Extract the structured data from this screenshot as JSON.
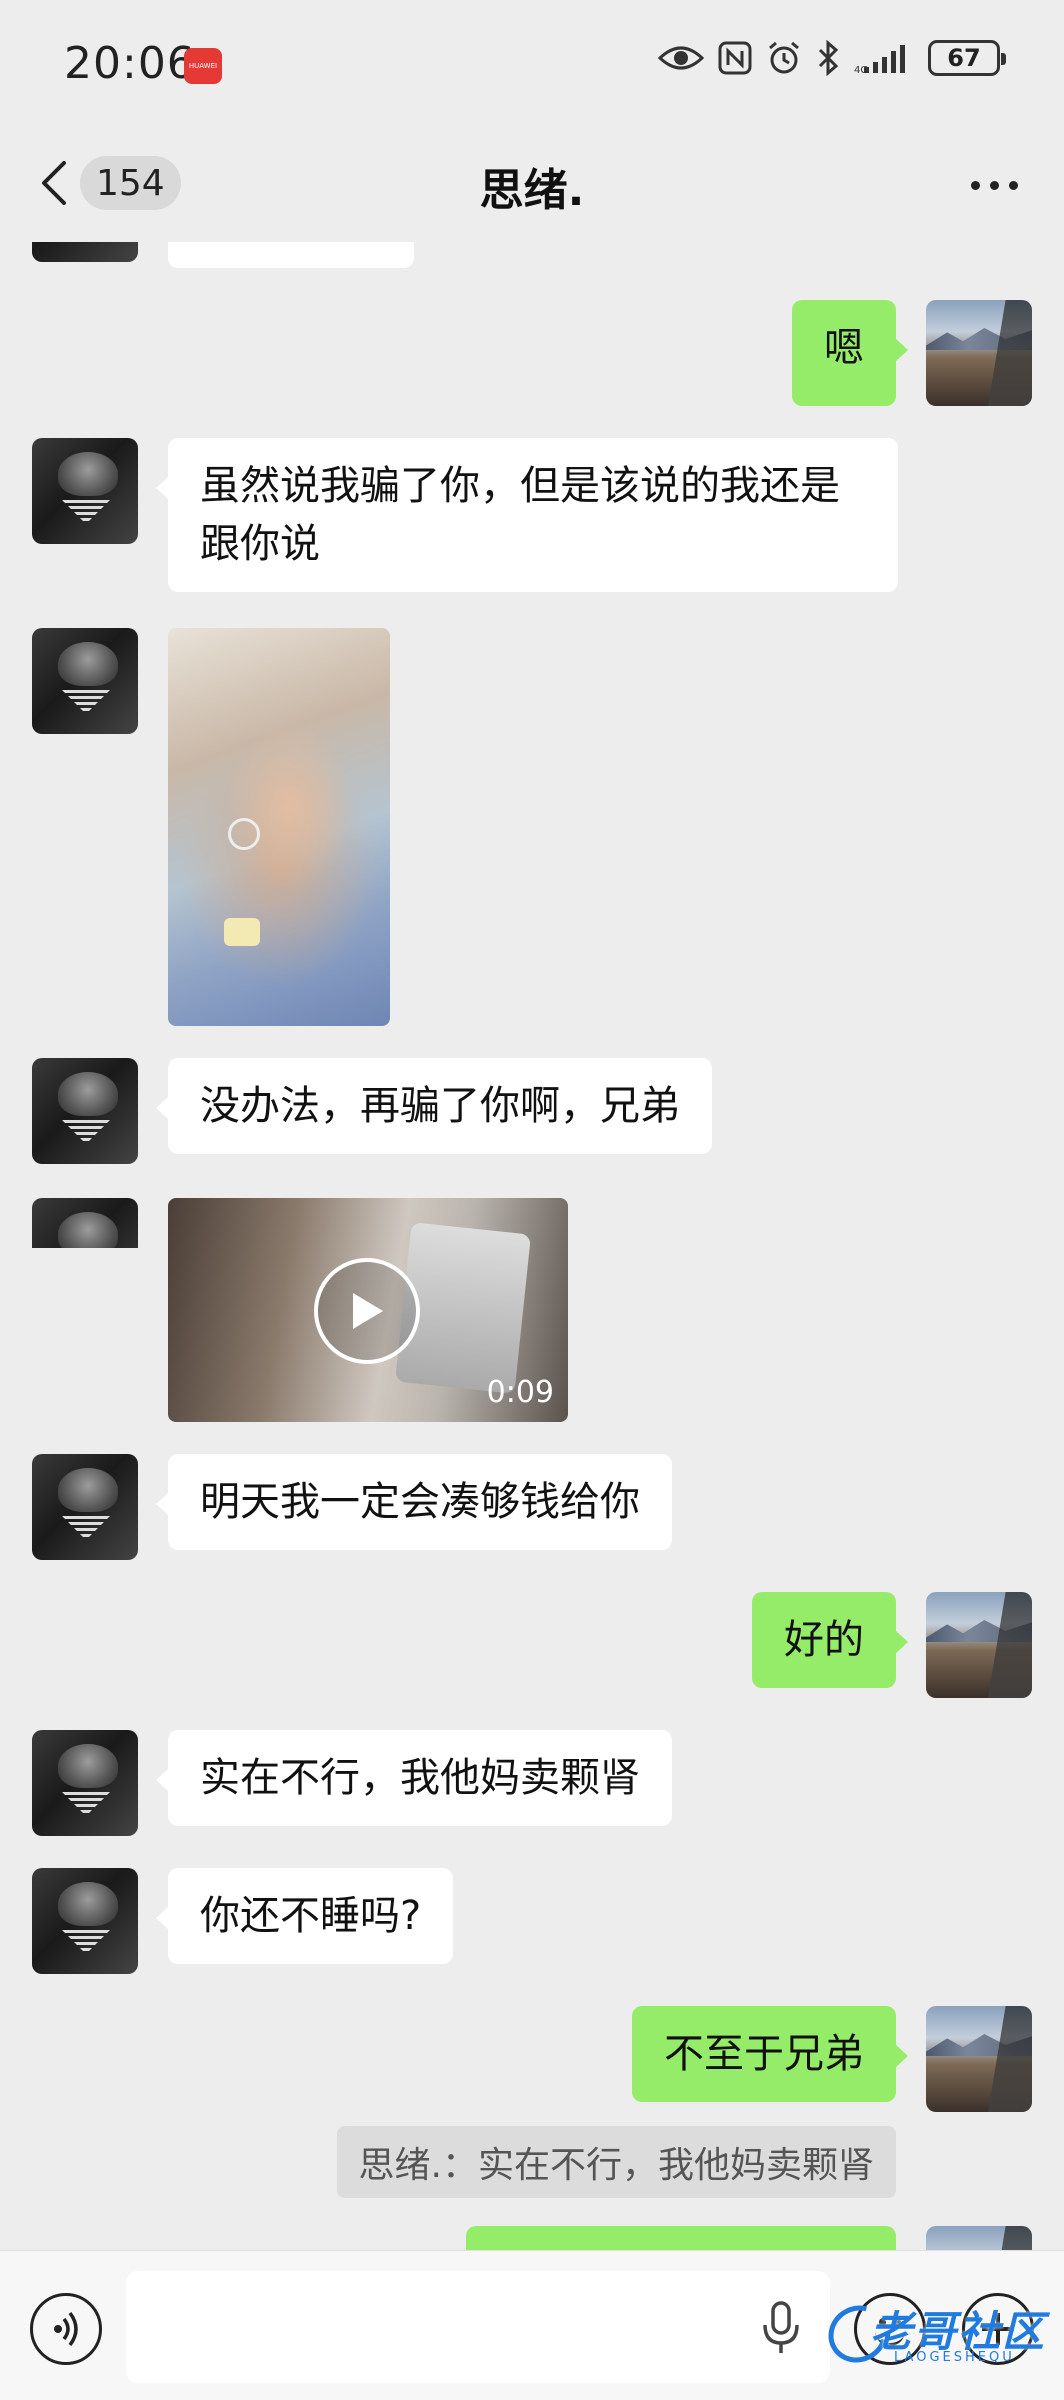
{
  "status_bar": {
    "time": "20:06",
    "badge": "HUAWEI",
    "battery": "67",
    "icons": [
      "eye-icon",
      "nfc-icon",
      "alarm-icon",
      "bluetooth-icon",
      "signal-icon",
      "battery-icon"
    ]
  },
  "nav": {
    "unread_count": "154",
    "title": "思绪.",
    "icons": [
      "chevron-left-icon",
      "more-icon"
    ]
  },
  "messages": [
    {
      "side": "in",
      "type": "text",
      "text": ""
    },
    {
      "side": "out",
      "type": "text",
      "text": "嗯"
    },
    {
      "side": "in",
      "type": "text",
      "text": "虽然说我骗了你，但是该说的我还是跟你说"
    },
    {
      "side": "in",
      "type": "image"
    },
    {
      "side": "in",
      "type": "text",
      "text": "没办法，再骗了你啊，兄弟"
    },
    {
      "side": "in",
      "type": "video",
      "duration": "0:09"
    },
    {
      "side": "in",
      "type": "text",
      "text": "明天我一定会凑够钱给你"
    },
    {
      "side": "out",
      "type": "text",
      "text": "好的"
    },
    {
      "side": "in",
      "type": "text",
      "text": "实在不行，我他妈卖颗肾"
    },
    {
      "side": "in",
      "type": "text",
      "text": "你还不睡吗?"
    },
    {
      "side": "out",
      "type": "text",
      "text": "不至于兄弟"
    },
    {
      "side": "quote",
      "type": "quote",
      "text": "思绪.：实在不行，我他妈卖颗肾"
    },
    {
      "side": "out",
      "type": "text",
      "text": ""
    }
  ],
  "input_bar": {
    "placeholder": "",
    "icons": [
      "voice-icon",
      "mic-icon",
      "emoji-icon",
      "plus-icon"
    ]
  },
  "watermark": {
    "text": "老哥社区",
    "sub": "LAOGESHEQU"
  },
  "colors": {
    "background": "#ededed",
    "incoming_bubble": "#ffffff",
    "outgoing_bubble": "#95ec69",
    "badge_red": "#e53935",
    "watermark_blue": "#1f7be0"
  }
}
